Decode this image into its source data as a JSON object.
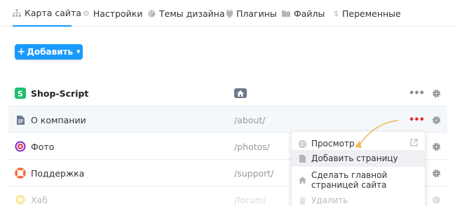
{
  "tabs": [
    {
      "label": "Карта сайта",
      "icon": "sitemap-icon",
      "active": true
    },
    {
      "label": "Настройки",
      "icon": "gear-icon",
      "active": false
    },
    {
      "label": "Темы дизайна",
      "icon": "palette-icon",
      "active": false
    },
    {
      "label": "Плагины",
      "icon": "plug-icon",
      "active": false
    },
    {
      "label": "Файлы",
      "icon": "folder-icon",
      "active": false
    },
    {
      "label": "Переменные",
      "icon": "dollar-icon",
      "active": false
    }
  ],
  "add_button": {
    "plus": "+",
    "label": "Добавить",
    "caret": "▼"
  },
  "rows": [
    {
      "name": "Shop-Script",
      "url": "",
      "icon": "shop-script-logo",
      "home": true
    },
    {
      "name": "О компании",
      "url": "/about/",
      "icon": "page-icon"
    },
    {
      "name": "Фото",
      "url": "/photos/",
      "icon": "photos-app-icon"
    },
    {
      "name": "Поддержка",
      "url": "/support/",
      "icon": "helpdesk-icon"
    },
    {
      "name": "Хаб",
      "url": "/forum/",
      "icon": "hub-icon"
    }
  ],
  "row_actions": {
    "dots": "•••"
  },
  "menu": {
    "items": [
      {
        "label": "Просмотр",
        "icon": "globe-icon"
      },
      {
        "label": "Добавить страницу",
        "icon": "page-add-icon"
      },
      {
        "label_line1": "Сделать главной",
        "label_line2": "страницей сайта",
        "icon": "home-icon"
      },
      {
        "label": "Удалить",
        "icon": "trash-icon"
      }
    ]
  },
  "colors": {
    "accent": "#1a9afe",
    "arrow": "#f5b55a",
    "active_dots": "#e03030"
  }
}
